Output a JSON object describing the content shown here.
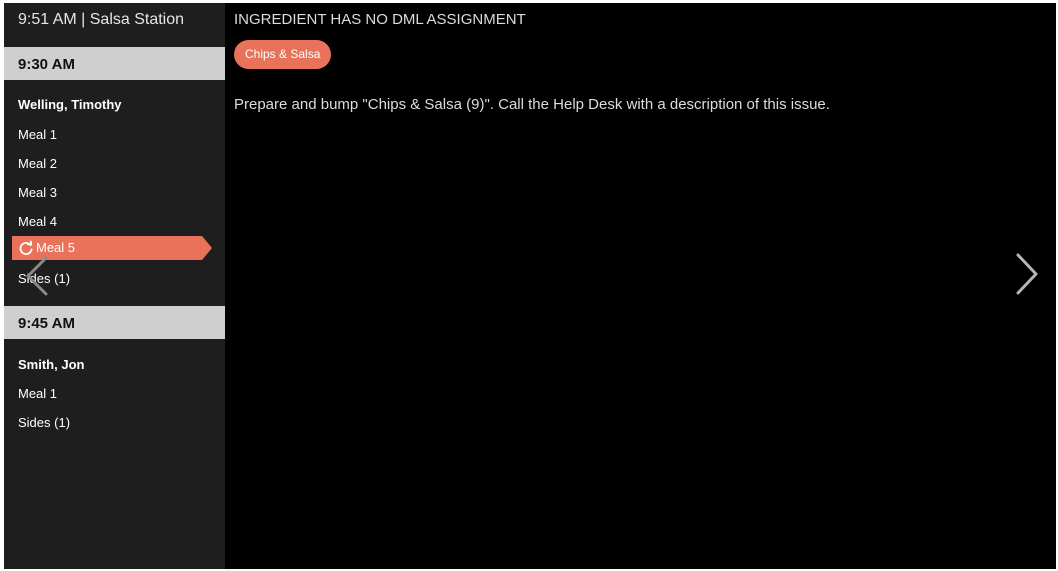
{
  "sidebar": {
    "station_header": "9:51 AM | Salsa Station",
    "time_blocks": [
      {
        "time": "9:30 AM",
        "customer": "Welling, Timothy",
        "items": [
          "Meal 1",
          "Meal 2",
          "Meal 3",
          "Meal 4",
          "Meal 5",
          "Sides (1)"
        ],
        "active_item": "Meal 5"
      },
      {
        "time": "9:45 AM",
        "customer": "Smith, Jon",
        "items": [
          "Meal 1",
          "Sides (1)"
        ]
      }
    ]
  },
  "main": {
    "title": "INGREDIENT HAS NO DML ASSIGNMENT",
    "ingredient_tag": "Chips & Salsa",
    "instructions": "Prepare and bump \"Chips & Salsa (9)\".  Call the Help Desk with a description of this issue."
  },
  "icons": {
    "active_item_icon": "refresh-icon",
    "prev_icon": "chevron-left-icon",
    "next_icon": "chevron-right-icon"
  },
  "colors": {
    "accent": "#e8735a",
    "sidebar_bg": "#1e1e1e",
    "time_block_bg": "#cfcfcf",
    "main_bg": "#000000"
  }
}
